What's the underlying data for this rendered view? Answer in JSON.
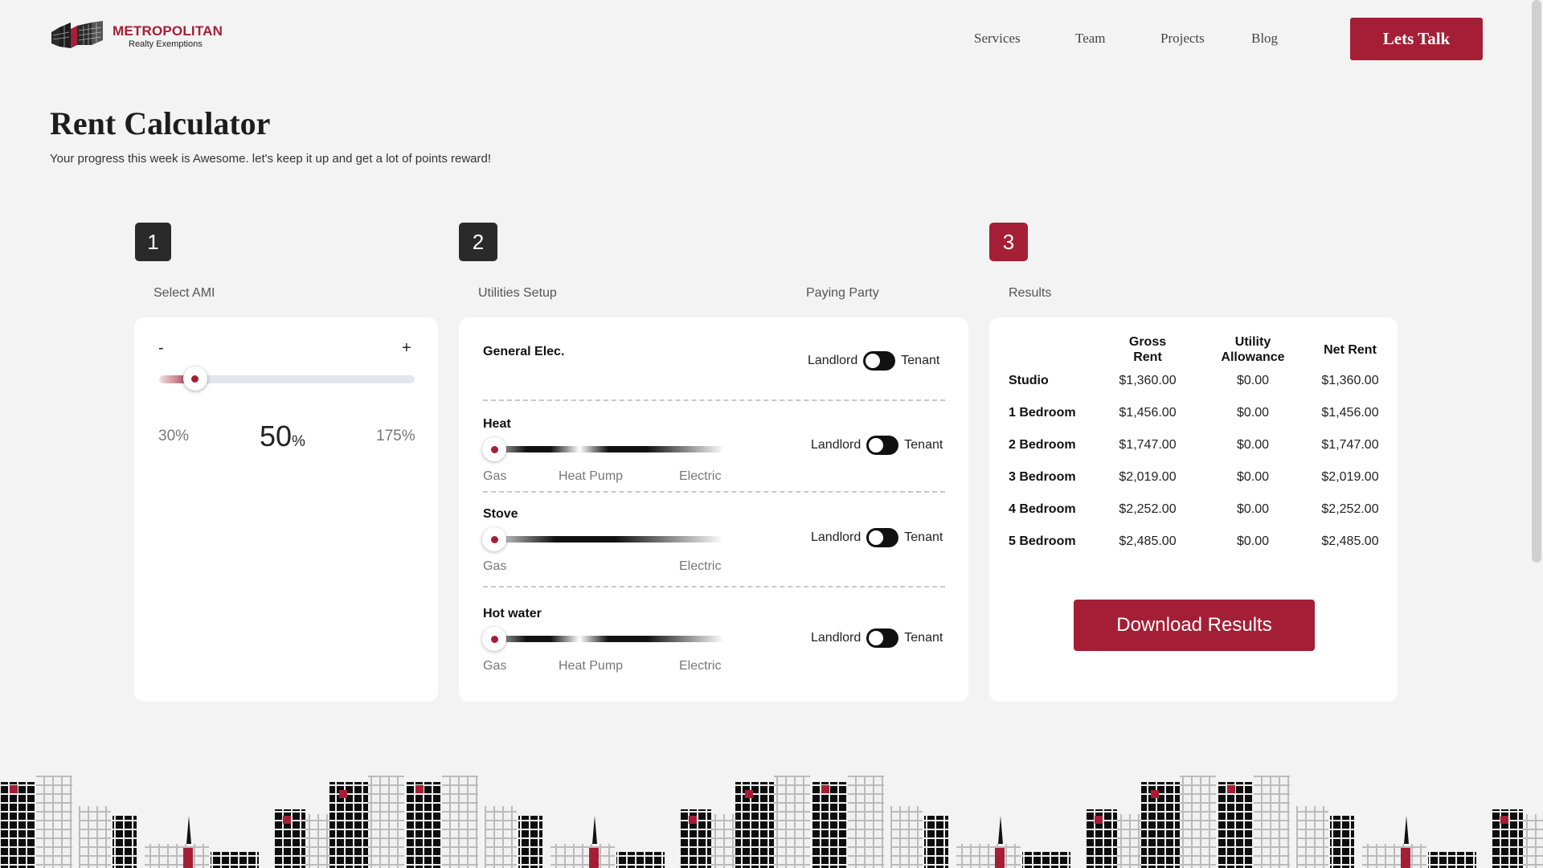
{
  "header": {
    "logo_name": "METROPOLITAN",
    "logo_sub": "Realty Exemptions",
    "nav": [
      "Services",
      "Team",
      "Projects",
      "Blog"
    ],
    "cta": "Lets Talk"
  },
  "page": {
    "title": "Rent Calculator",
    "subtitle": "Your progress this week is Awesome. let's keep it up and get a lot of points reward!"
  },
  "steps": [
    {
      "number": "1",
      "label": "Select AMI"
    },
    {
      "number": "2",
      "label": "Utilities Setup",
      "extra_label": "Paying Party"
    },
    {
      "number": "3",
      "label": "Results"
    }
  ],
  "ami": {
    "minus": "-",
    "plus": "+",
    "min_label": "30%",
    "max_label": "175%",
    "value": "50",
    "unit": "%",
    "slider_level": 0.14
  },
  "utilities": [
    {
      "name": "General Elec.",
      "landlord": "Landlord",
      "tenant": "Tenant"
    },
    {
      "name": "Heat",
      "landlord": "Landlord",
      "tenant": "Tenant",
      "options": [
        "Gas",
        "Heat Pump",
        "Electric"
      ],
      "selected": "Gas"
    },
    {
      "name": "Stove",
      "landlord": "Landlord",
      "tenant": "Tenant",
      "options": [
        "Gas",
        "Electric"
      ],
      "selected": "Gas"
    },
    {
      "name": "Hot water",
      "landlord": "Landlord",
      "tenant": "Tenant",
      "options": [
        "Gas",
        "Heat Pump",
        "Electric"
      ],
      "selected": "Gas"
    }
  ],
  "results": {
    "headers": [
      "Gross Rent",
      "Utility Allowance",
      "Net Rent"
    ],
    "rows": [
      {
        "unit": "Studio",
        "gross": "$1,360.00",
        "allowance": "$0.00",
        "net": "$1,360.00"
      },
      {
        "unit": "1 Bedroom",
        "gross": "$1,456.00",
        "allowance": "$0.00",
        "net": "$1,456.00"
      },
      {
        "unit": "2 Bedroom",
        "gross": "$1,747.00",
        "allowance": "$0.00",
        "net": "$1,747.00"
      },
      {
        "unit": "3 Bedroom",
        "gross": "$2,019.00",
        "allowance": "$0.00",
        "net": "$2,019.00"
      },
      {
        "unit": "4 Bedroom",
        "gross": "$2,252.00",
        "allowance": "$0.00",
        "net": "$2,252.00"
      },
      {
        "unit": "5 Bedroom",
        "gross": "$2,485.00",
        "allowance": "$0.00",
        "net": "$2,485.00"
      }
    ],
    "download": "Download Results"
  },
  "colors": {
    "accent": "#a41f35",
    "dark": "#2a2a2a",
    "background": "#f3f3f3"
  }
}
